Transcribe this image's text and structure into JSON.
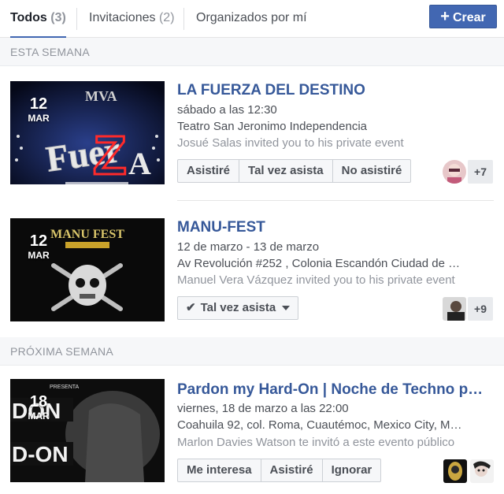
{
  "tabs": [
    {
      "label": "Todos",
      "count": "3"
    },
    {
      "label": "Invitaciones",
      "count": "2"
    },
    {
      "label": "Organizados por mí",
      "count": ""
    }
  ],
  "create_button": {
    "label": "Crear",
    "icon": "plus-icon"
  },
  "sections": [
    {
      "heading": "ESTA SEMANA"
    },
    {
      "heading": "PRÓXIMA SEMANA"
    }
  ],
  "events": [
    {
      "day": "12",
      "month": "MAR",
      "title": "LA FUERZA DEL DESTINO",
      "when": "sábado a las 12:30",
      "where": "Teatro San Jeronimo Independencia",
      "invite": "Josué Salas invited you to his private event",
      "buttons": [
        "Asistiré",
        "Tal vez asista",
        "No asistiré"
      ],
      "more": "+7"
    },
    {
      "day": "12",
      "month": "MAR",
      "title": "MANU-FEST",
      "when": "12 de marzo - 13 de marzo",
      "where": "Av Revolución #252 , Colonia Escandón Ciudad de …",
      "invite": "Manuel Vera Vázquez invited you to his private event",
      "rsvp": "Tal vez asista",
      "more": "+9"
    },
    {
      "day": "18",
      "month": "MAR",
      "title": "Pardon my Hard-On | Noche de Techno p…",
      "when": "viernes, 18 de marzo a las 22:00",
      "where": "Coahuila 92, col. Roma, Cuautémoc, Mexico City, M…",
      "invite": "Marlon Davies Watson te invitó a este evento público",
      "buttons": [
        "Me interesa",
        "Asistiré",
        "Ignorar"
      ]
    }
  ],
  "thumb_text": {
    "e1_brand": "MVA",
    "e2_brand": "MANU FEST",
    "e3_presenta": "PRESENTA",
    "e3_word1": "DON",
    "e3_word2": "D-ON"
  },
  "colors": {
    "accent": "#4267b2",
    "link": "#365899",
    "section_bg": "#f6f7f9"
  }
}
